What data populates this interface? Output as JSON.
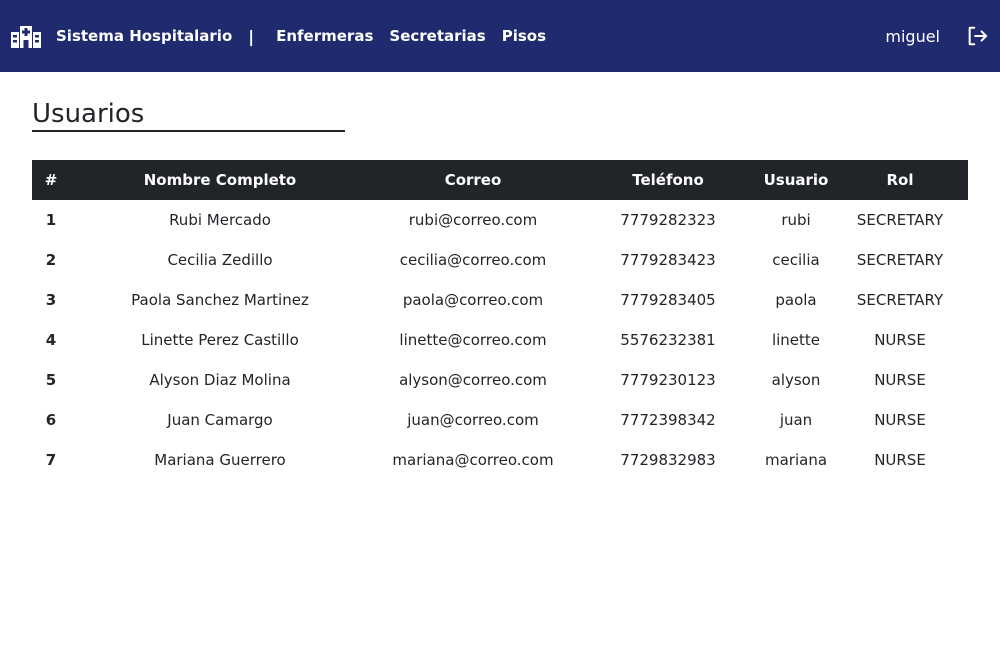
{
  "navbar": {
    "brand": "Sistema Hospitalario",
    "separator": "|",
    "links": [
      "Enfermeras",
      "Secretarias",
      "Pisos"
    ],
    "user": "miguel",
    "background": "#1f2b6e"
  },
  "page": {
    "title": "Usuarios"
  },
  "table": {
    "headers": [
      "#",
      "Nombre Completo",
      "Correo",
      "Teléfono",
      "Usuario",
      "Rol"
    ],
    "rows": [
      [
        "1",
        "Rubi Mercado",
        "rubi@correo.com",
        "7779282323",
        "rubi",
        "SECRETARY"
      ],
      [
        "2",
        "Cecilia Zedillo",
        "cecilia@correo.com",
        "7779283423",
        "cecilia",
        "SECRETARY"
      ],
      [
        "3",
        "Paola Sanchez Martinez",
        "paola@correo.com",
        "7779283405",
        "paola",
        "SECRETARY"
      ],
      [
        "4",
        "Linette Perez Castillo",
        "linette@correo.com",
        "5576232381",
        "linette",
        "NURSE"
      ],
      [
        "5",
        "Alyson Diaz Molina",
        "alyson@correo.com",
        "7779230123",
        "alyson",
        "NURSE"
      ],
      [
        "6",
        "Juan Camargo",
        "juan@correo.com",
        "7772398342",
        "juan",
        "NURSE"
      ],
      [
        "7",
        "Mariana Guerrero",
        "mariana@correo.com",
        "7729832983",
        "mariana",
        "NURSE"
      ]
    ]
  },
  "icons": {
    "brand": "hospital-icon",
    "logout": "logout-icon"
  }
}
